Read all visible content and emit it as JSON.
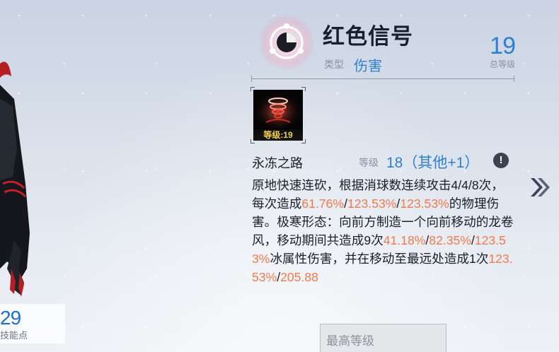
{
  "skill": {
    "name": "红色信号",
    "type_label": "类型",
    "type_value": "伤害",
    "total_level": "19",
    "total_level_label": "总等级",
    "icon_level_tag": "等级:19"
  },
  "subskill": {
    "name": "永冻之路",
    "level_label": "等级",
    "level_value": "18（其他+1）",
    "info_icon": "!"
  },
  "description": {
    "segments": [
      {
        "t": "原地快速连砍，根据消球数连续攻击4/4/8次，每次造成"
      },
      {
        "t": "61.76%",
        "hl": true
      },
      {
        "t": "/"
      },
      {
        "t": "123.53%",
        "hl": true
      },
      {
        "t": "/"
      },
      {
        "t": "123.53%",
        "hl": true
      },
      {
        "t": "的物理伤害。极寒形态：向前方制造一个向前移动的龙卷风，移动期间共造成9次"
      },
      {
        "t": "41.18%",
        "hl": true
      },
      {
        "t": "/"
      },
      {
        "t": "82.35%",
        "hl": true
      },
      {
        "t": "/"
      },
      {
        "t": "123.53%",
        "hl": true
      },
      {
        "t": "冰属性伤害，并在移动至最远处造成1次"
      },
      {
        "t": "123.53%",
        "hl": true
      },
      {
        "t": "/"
      },
      {
        "t": "205.88",
        "hl": true
      }
    ]
  },
  "left_panel": {
    "skill_points_value": "29",
    "skill_points_label": "技能点"
  },
  "buttons": {
    "max_level": "最高等级"
  },
  "colors": {
    "accent_blue": "#2f7fd3",
    "highlight_orange": "#f17a4c",
    "icon_level_yellow": "#f4d246"
  },
  "icons": {
    "emblem": "red-signal-emblem-icon",
    "skill_icon": "red-tornado-skill-icon",
    "next": "double-chevron-right-icon",
    "info": "exclamation-icon"
  }
}
